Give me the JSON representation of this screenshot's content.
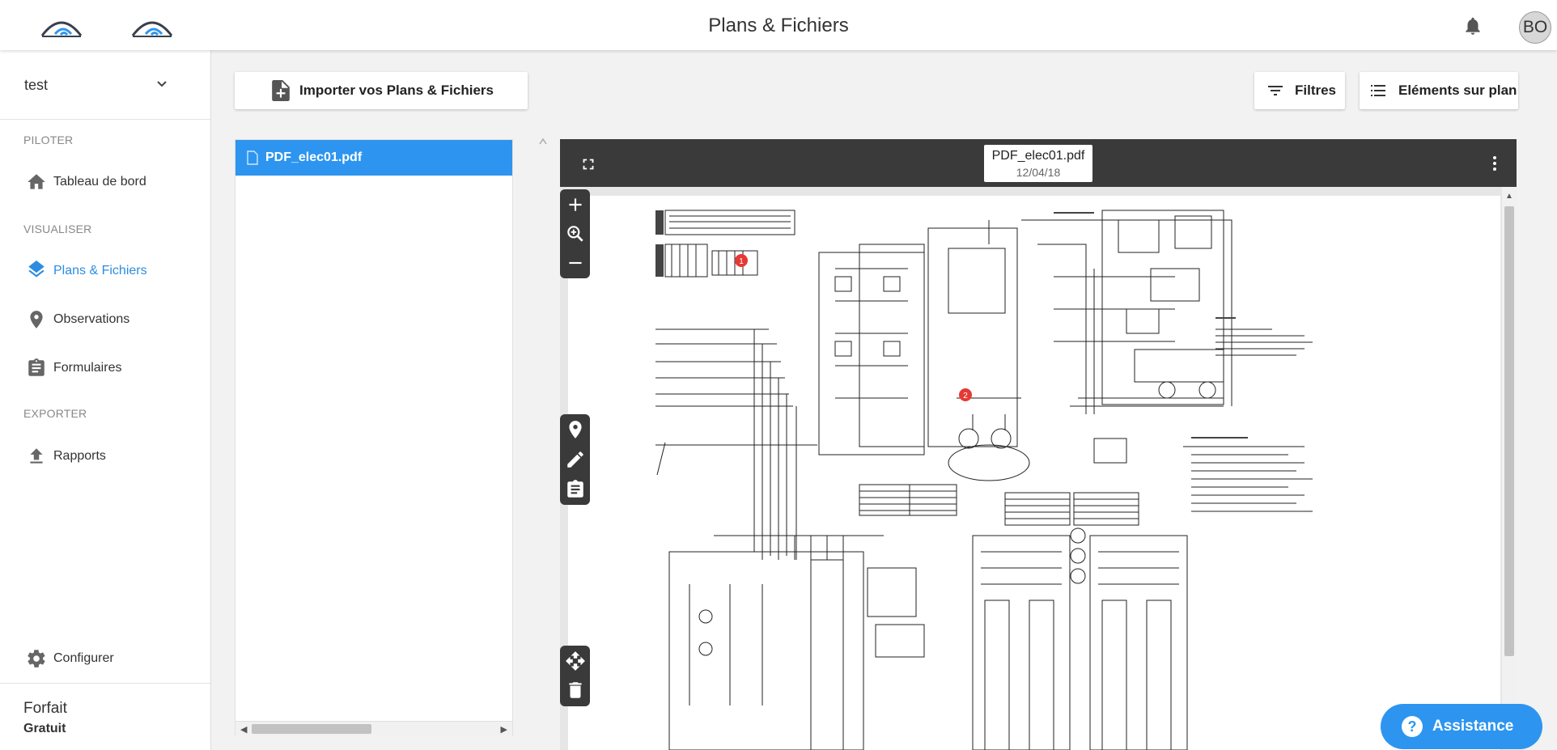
{
  "header": {
    "title": "Plans & Fichiers",
    "avatar_initials": "BO",
    "logo_icon": "wifi-arc-logo",
    "bell_icon": "bell-icon"
  },
  "sidebar": {
    "project": "test",
    "sections": {
      "piloter": "PILOTER",
      "visualiser": "VISUALISER",
      "exporter": "EXPORTER"
    },
    "items": [
      {
        "label": "Tableau de bord",
        "icon": "home-icon",
        "active": false
      },
      {
        "label": "Plans & Fichiers",
        "icon": "layers-icon",
        "active": true
      },
      {
        "label": "Observations",
        "icon": "map-pin-icon",
        "active": false
      },
      {
        "label": "Formulaires",
        "icon": "clipboard-icon",
        "active": false
      },
      {
        "label": "Rapports",
        "icon": "upload-icon",
        "active": false
      },
      {
        "label": "Configurer",
        "icon": "gear-icon",
        "active": false
      }
    ],
    "plan": {
      "title": "Forfait",
      "value": "Gratuit"
    }
  },
  "toolbar": {
    "import_label": "Importer vos Plans & Fichiers",
    "filters_label": "Filtres",
    "elements_label": "Eléments sur plan"
  },
  "files": [
    {
      "name": "PDF_elec01.pdf",
      "selected": true
    }
  ],
  "viewer": {
    "file_name": "PDF_elec01.pdf",
    "file_date": "12/04/18",
    "markers": [
      "1",
      "2"
    ]
  },
  "assistance_label": "Assistance",
  "colors": {
    "accent": "#2d95f0",
    "active_text": "#2d8ce0",
    "dark_toolbar": "#3a3a3a",
    "marker": "#e53935"
  }
}
